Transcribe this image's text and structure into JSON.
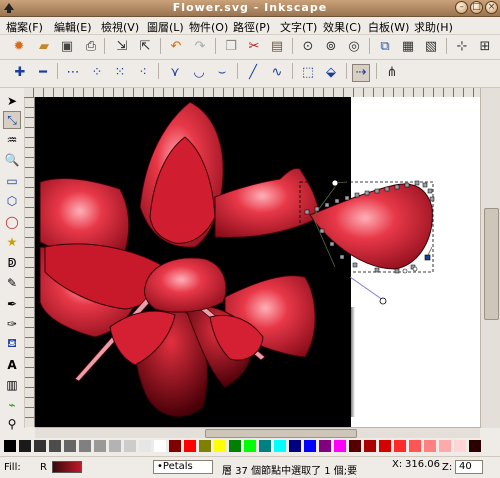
{
  "window": {
    "title": "Flower.svg - Inkscape"
  },
  "menu": [
    {
      "label": "檔案(F)",
      "key": "file"
    },
    {
      "label": "編輯(E)",
      "key": "edit"
    },
    {
      "label": "檢視(V)",
      "key": "view"
    },
    {
      "label": "圖層(L)",
      "key": "layer"
    },
    {
      "label": "物件(O)",
      "key": "object"
    },
    {
      "label": "路徑(P)",
      "key": "path"
    },
    {
      "label": "文字(T)",
      "key": "text"
    },
    {
      "label": "效果(C)",
      "key": "effects"
    },
    {
      "label": "白板(W)",
      "key": "whiteboard"
    },
    {
      "label": "求助(H)",
      "key": "help"
    }
  ],
  "status": {
    "fill_label": "Fill:",
    "layer": "•Petals",
    "message": "層 37 個節點中選取了 1 個;要",
    "coord_x_label": "X:",
    "coord_x": "316.06",
    "zoom_label": "Z:",
    "zoom": "40",
    "fill_value_letter": "R"
  },
  "palette": [
    "#000000",
    "#1a1a1a",
    "#333333",
    "#4d4d4d",
    "#666666",
    "#808080",
    "#999999",
    "#b3b3b3",
    "#cccccc",
    "#e6e6e6",
    "#ffffff",
    "#800000",
    "#ff0000",
    "#808000",
    "#ffff00",
    "#008000",
    "#00ff00",
    "#008080",
    "#00ffff",
    "#000080",
    "#0000ff",
    "#800080",
    "#ff00ff",
    "#550000",
    "#aa0000",
    "#d40000",
    "#ff2a2a",
    "#ff5555",
    "#ff8080",
    "#ffaaaa",
    "#ffd5d5",
    "#2b0000"
  ],
  "colors": {
    "accent_red": "#d62036",
    "canvas_black": "#000000"
  }
}
